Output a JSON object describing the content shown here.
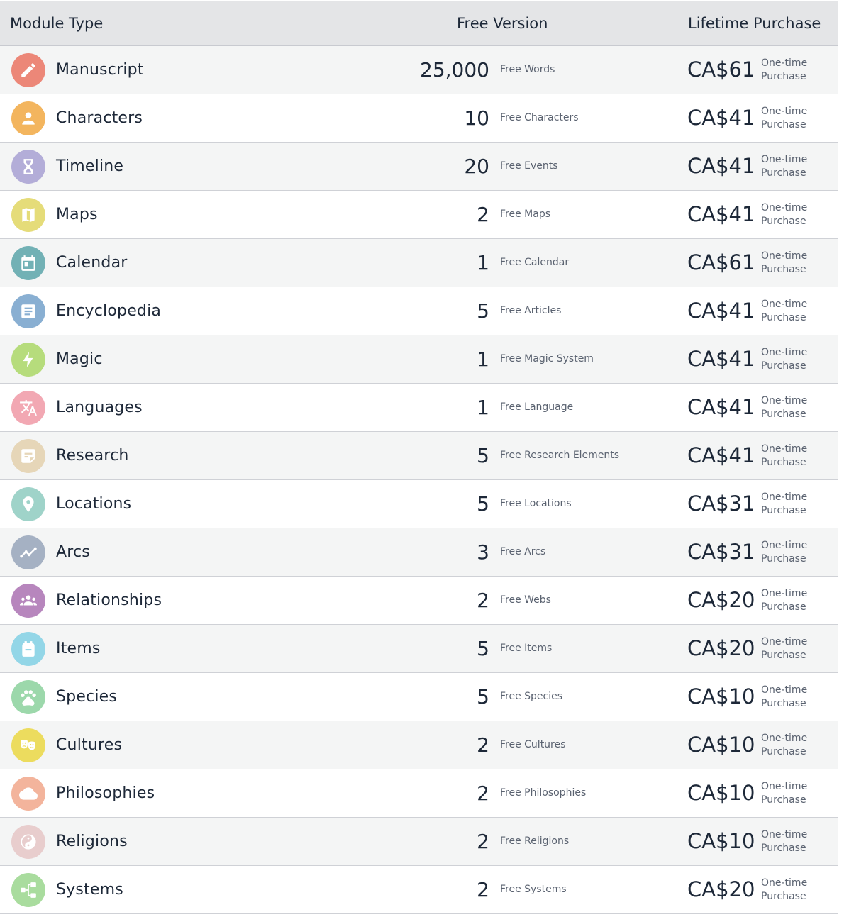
{
  "headers": {
    "module_type": "Module Type",
    "free_version": "Free Version",
    "lifetime_purchase": "Lifetime Purchase"
  },
  "purchase_type_line1": "One-time",
  "purchase_type_line2": "Purchase",
  "modules": [
    {
      "name": "Manuscript",
      "icon": "pencil-icon",
      "color": "#ec8778",
      "free_qty": "25,000",
      "free_label": "Free Words",
      "price": "CA$61"
    },
    {
      "name": "Characters",
      "icon": "person-icon",
      "color": "#f3b55e",
      "free_qty": "10",
      "free_label": "Free Characters",
      "price": "CA$41"
    },
    {
      "name": "Timeline",
      "icon": "hourglass-icon",
      "color": "#b3add8",
      "free_qty": "20",
      "free_label": "Free Events",
      "price": "CA$41"
    },
    {
      "name": "Maps",
      "icon": "map-icon",
      "color": "#e5dc79",
      "free_qty": "2",
      "free_label": "Free Maps",
      "price": "CA$41"
    },
    {
      "name": "Calendar",
      "icon": "calendar-icon",
      "color": "#72b1b5",
      "free_qty": "1",
      "free_label": "Free Calendar",
      "price": "CA$61"
    },
    {
      "name": "Encyclopedia",
      "icon": "article-icon",
      "color": "#89afd2",
      "free_qty": "5",
      "free_label": "Free Articles",
      "price": "CA$41"
    },
    {
      "name": "Magic",
      "icon": "lightning-icon",
      "color": "#b6dc7c",
      "free_qty": "1",
      "free_label": "Free Magic System",
      "price": "CA$41"
    },
    {
      "name": "Languages",
      "icon": "translate-icon",
      "color": "#f2a8b3",
      "free_qty": "1",
      "free_label": "Free Language",
      "price": "CA$41"
    },
    {
      "name": "Research",
      "icon": "sticky-note-icon",
      "color": "#e6d6b8",
      "free_qty": "5",
      "free_label": "Free Research Elements",
      "price": "CA$41"
    },
    {
      "name": "Locations",
      "icon": "location-pin-icon",
      "color": "#9fd3c9",
      "free_qty": "5",
      "free_label": "Free Locations",
      "price": "CA$31"
    },
    {
      "name": "Arcs",
      "icon": "trend-line-icon",
      "color": "#a5b1c3",
      "free_qty": "3",
      "free_label": "Free Arcs",
      "price": "CA$31"
    },
    {
      "name": "Relationships",
      "icon": "group-icon",
      "color": "#b786bd",
      "free_qty": "2",
      "free_label": "Free Webs",
      "price": "CA$20"
    },
    {
      "name": "Items",
      "icon": "backpack-icon",
      "color": "#93d6e7",
      "free_qty": "5",
      "free_label": "Free Items",
      "price": "CA$20"
    },
    {
      "name": "Species",
      "icon": "paw-icon",
      "color": "#9cd8ab",
      "free_qty": "5",
      "free_label": "Free Species",
      "price": "CA$10"
    },
    {
      "name": "Cultures",
      "icon": "theater-masks-icon",
      "color": "#ecdc5e",
      "free_qty": "2",
      "free_label": "Free Cultures",
      "price": "CA$10"
    },
    {
      "name": "Philosophies",
      "icon": "cloud-icon",
      "color": "#f3b49c",
      "free_qty": "2",
      "free_label": "Free Philosophies",
      "price": "CA$10"
    },
    {
      "name": "Religions",
      "icon": "yin-yang-icon",
      "color": "#e8cdcd",
      "free_qty": "2",
      "free_label": "Free Religions",
      "price": "CA$10"
    },
    {
      "name": "Systems",
      "icon": "hierarchy-icon",
      "color": "#a9dc9e",
      "free_qty": "2",
      "free_label": "Free Systems",
      "price": "CA$20"
    }
  ]
}
